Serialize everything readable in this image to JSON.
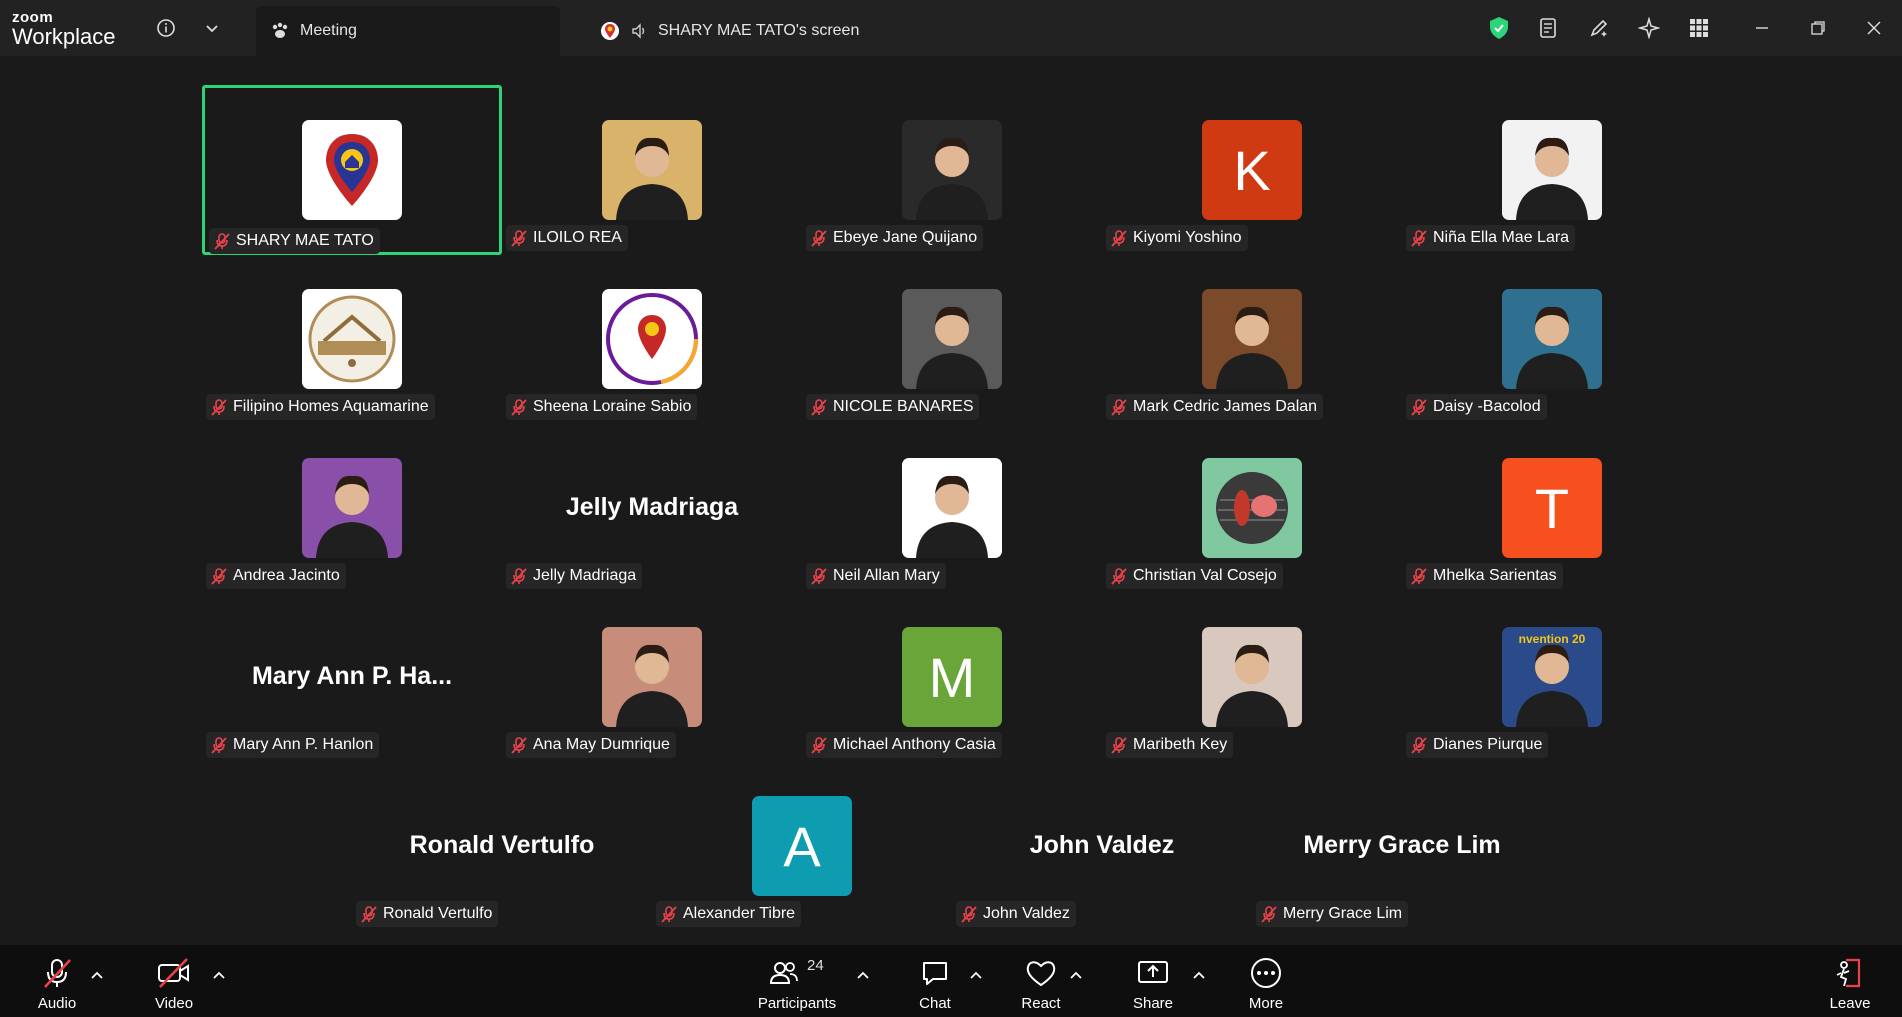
{
  "app": {
    "brand_small": "zoom",
    "brand_big": "Workplace",
    "tabs": [
      {
        "label": "Meeting"
      },
      {
        "label": "SHARY MAE TATO's screen"
      }
    ]
  },
  "colors": {
    "active_border": "#2ed47a",
    "muted_red": "#e8434b",
    "shield_green": "#2ed47a"
  },
  "participants": [
    {
      "name": "SHARY MAE TATO",
      "avatar": "pin-logo",
      "active": true
    },
    {
      "name": "ILOILO REA",
      "avatar": "photo",
      "bg": "#d9b36a"
    },
    {
      "name": "Ebeye Jane Quijano",
      "avatar": "photo",
      "bg": "#2a2a2a"
    },
    {
      "name": "Kiyomi Yoshino",
      "avatar": "initial",
      "initial": "K",
      "bg": "#cf3a12"
    },
    {
      "name": "Niña Ella Mae Lara",
      "avatar": "photo",
      "bg": "#f2f2f2"
    },
    {
      "name": "Filipino Homes Aquamarine",
      "avatar": "aquamarine-logo"
    },
    {
      "name": "Sheena Loraine Sabio",
      "avatar": "ring-logo"
    },
    {
      "name": "NICOLE BANARES",
      "avatar": "photo",
      "bg": "#5a5a5a"
    },
    {
      "name": "Mark Cedric James Dalan",
      "avatar": "photo",
      "bg": "#7a4a2a"
    },
    {
      "name": "Daisy -Bacolod",
      "avatar": "photo",
      "bg": "#2f6f8f"
    },
    {
      "name": "Andrea Jacinto",
      "avatar": "photo",
      "bg": "#8a4fa8"
    },
    {
      "name": "Jelly Madriaga",
      "avatar": "text",
      "display": "Jelly Madriaga"
    },
    {
      "name": "Neil Allan Mary",
      "avatar": "photo",
      "bg": "#ffffff"
    },
    {
      "name": "Christian Val Cosejo",
      "avatar": "grill-logo",
      "bg": "#7fc8a0"
    },
    {
      "name": "Mhelka Sarientas",
      "avatar": "initial",
      "initial": "T",
      "bg": "#f5501e"
    },
    {
      "name": "Mary Ann P. Hanlon",
      "avatar": "text",
      "display": "Mary Ann P. Ha..."
    },
    {
      "name": "Ana May Dumrique",
      "avatar": "photo",
      "bg": "#c78d7a"
    },
    {
      "name": "Michael Anthony Casia",
      "avatar": "initial",
      "initial": "M",
      "bg": "#6aa53a"
    },
    {
      "name": "Maribeth Key",
      "avatar": "photo",
      "bg": "#d9c8bd"
    },
    {
      "name": "Dianes Piurque",
      "avatar": "photo",
      "bg": "#2a4a8a",
      "caption": "nvention 20"
    },
    {
      "name": "Ronald Vertulfo",
      "avatar": "text",
      "display": "Ronald Vertulfo"
    },
    {
      "name": "Alexander Tibre",
      "avatar": "initial",
      "initial": "A",
      "bg": "#0e9cb0"
    },
    {
      "name": "John Valdez",
      "avatar": "text",
      "display": "John Valdez"
    },
    {
      "name": "Merry Grace Lim",
      "avatar": "text",
      "display": "Merry Grace Lim"
    }
  ],
  "toolbar": {
    "audio": "Audio",
    "video": "Video",
    "participants": "Participants",
    "participant_count": "24",
    "chat": "Chat",
    "react": "React",
    "share": "Share",
    "more": "More",
    "leave": "Leave"
  }
}
